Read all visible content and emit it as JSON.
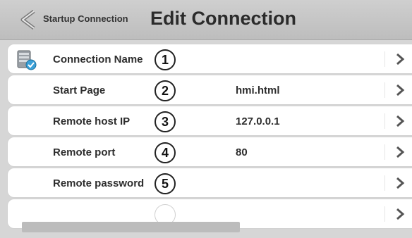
{
  "header": {
    "breadcrumb": "Startup Connection",
    "title": "Edit Connection"
  },
  "rows": [
    {
      "label": "Connection Name",
      "number": "1",
      "value": ""
    },
    {
      "label": "Start Page",
      "number": "2",
      "value": "hmi.html"
    },
    {
      "label": "Remote host IP",
      "number": "3",
      "value": "127.0.0.1"
    },
    {
      "label": "Remote port",
      "number": "4",
      "value": "80"
    },
    {
      "label": "Remote password",
      "number": "5",
      "value": ""
    },
    {
      "label": "",
      "number": "",
      "value": ""
    }
  ],
  "icons": {
    "back": "back-chevron-icon",
    "row_arrow": "chevron-right-icon",
    "connection": "database-connection-icon"
  },
  "colors": {
    "header_bg": "#c6c6c6",
    "page_bg": "#d6d6d6",
    "row_bg": "#ffffff"
  }
}
